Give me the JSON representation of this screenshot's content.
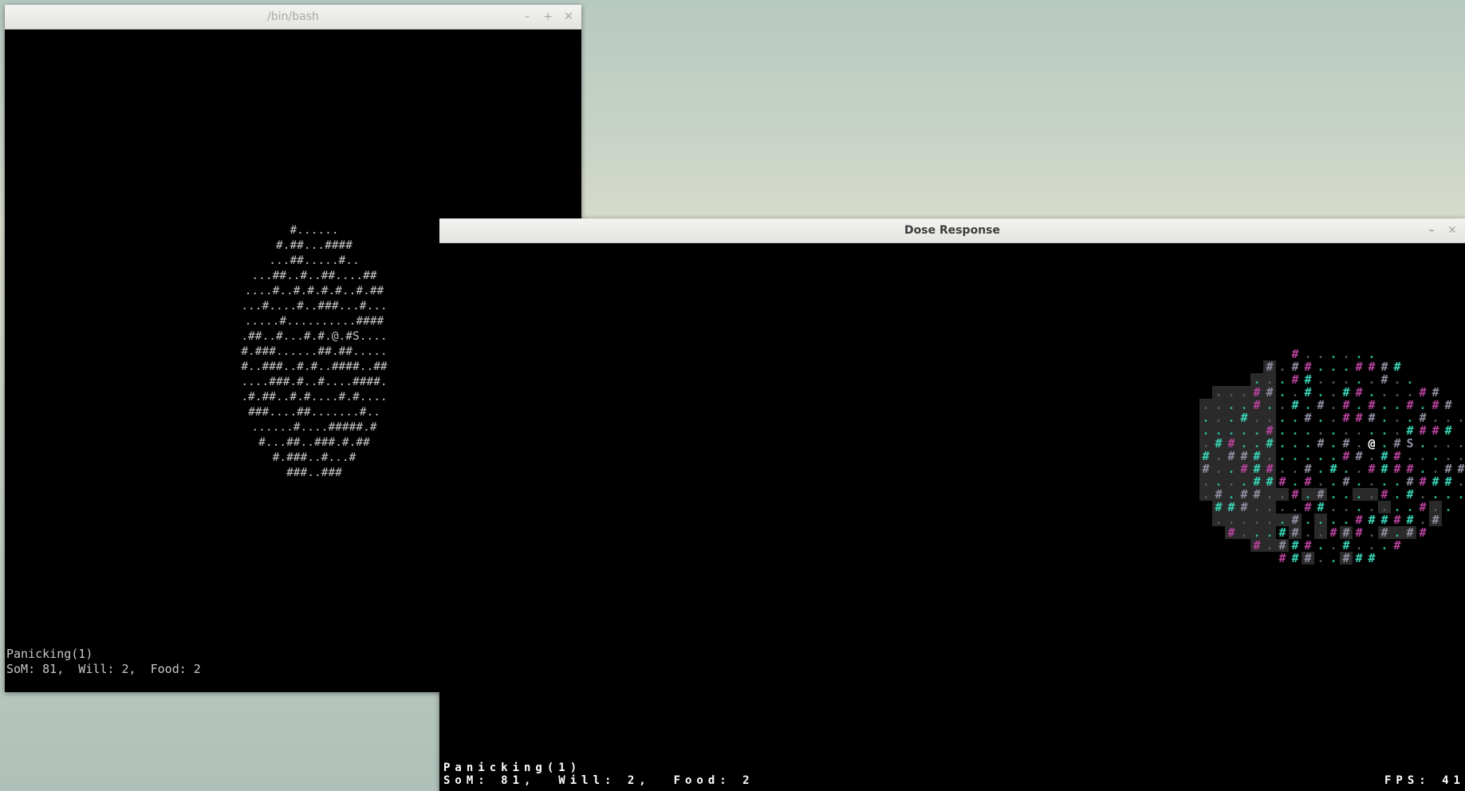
{
  "terminal": {
    "title": "/bin/bash",
    "map_lines": [
      "#......",
      "#.##...####",
      "...##.....#..",
      "...##..#..##....##",
      "....#..#.#.#.#..#.##",
      "...#....#..###...#...",
      ".....#..........####",
      ".##..#...#.#.@.#S....",
      "#.###......##.##.....",
      "#..###..#.#..####..##",
      "....###.#..#....####.",
      ".#.##..#.#....#.#....",
      "###....##.......#..",
      "......#....#####.#",
      "#...##..###.#.##",
      "#.###..#...#",
      "###..###"
    ],
    "status_line": "Panicking(1)",
    "stats_line": "SoM: 81,  Will: 2,  Food: 2"
  },
  "game": {
    "title": "Dose Response",
    "colors": {
      "white": "#ffffff",
      "grey": "#8f8fa3",
      "teal": "#3ad6b8",
      "magenta": "#b8439c",
      "dim_floor": "#4e5f5a",
      "lit_floor": "#2ab79c",
      "explored_bg": "#2a2a2a"
    },
    "cols": [
      "grey",
      "teal",
      "magenta",
      "dim_floor",
      "lit_floor"
    ],
    "status_line": "Panicking(1)",
    "stats_line": "SoM: 81,  Will: 2,  Food: 2",
    "fps_label": "FPS: 41"
  },
  "window_controls": {
    "minimize": "–",
    "maximize": "+",
    "close": "✕"
  }
}
